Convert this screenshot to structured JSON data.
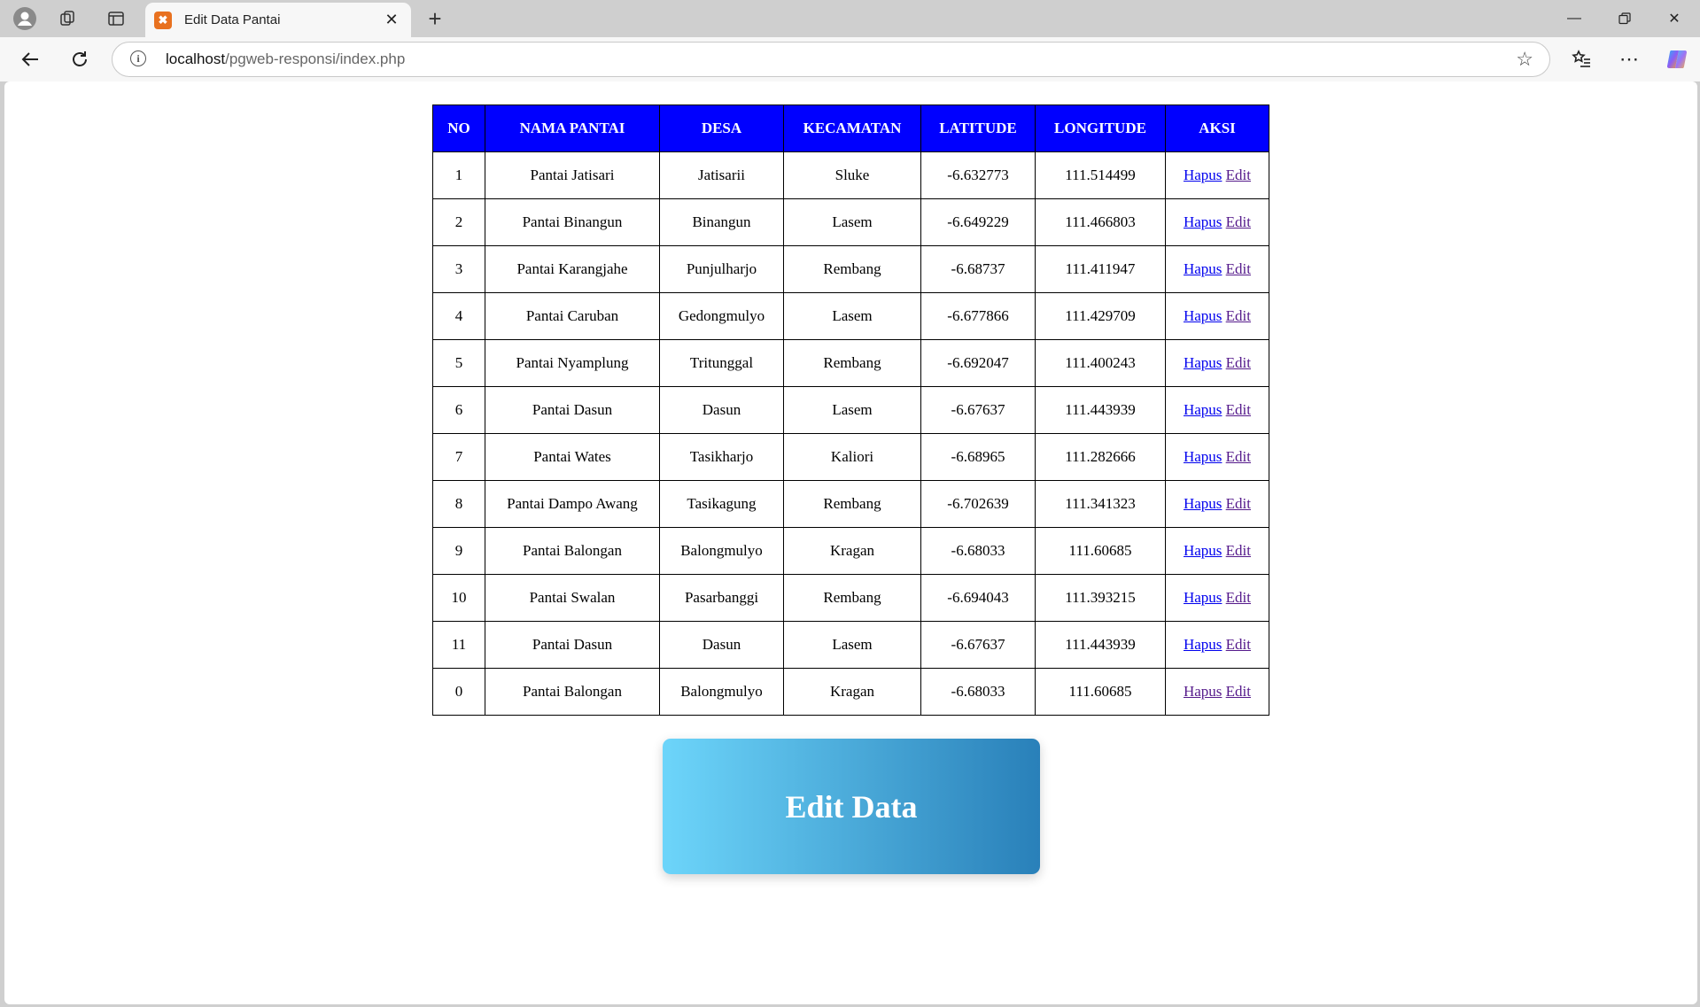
{
  "browser": {
    "tab_title": "Edit Data Pantai",
    "tab_favicon_letter": "✖",
    "url_host": "localhost",
    "url_path": "/pgweb-responsi/index.php"
  },
  "table": {
    "headers": [
      "NO",
      "NAMA PANTAI",
      "DESA",
      "KECAMATAN",
      "LATITUDE",
      "LONGITUDE",
      "AKSI"
    ],
    "action_delete_label": "Hapus",
    "action_edit_label": "Edit",
    "rows": [
      {
        "no": "1",
        "nama": "Pantai Jatisari",
        "desa": "Jatisarii",
        "kecamatan": "Sluke",
        "lat": "-6.632773",
        "lon": "111.514499"
      },
      {
        "no": "2",
        "nama": "Pantai Binangun",
        "desa": "Binangun",
        "kecamatan": "Lasem",
        "lat": "-6.649229",
        "lon": "111.466803"
      },
      {
        "no": "3",
        "nama": "Pantai Karangjahe",
        "desa": "Punjulharjo",
        "kecamatan": "Rembang",
        "lat": "-6.68737",
        "lon": "111.411947"
      },
      {
        "no": "4",
        "nama": "Pantai Caruban",
        "desa": "Gedongmulyo",
        "kecamatan": "Lasem",
        "lat": "-6.677866",
        "lon": "111.429709"
      },
      {
        "no": "5",
        "nama": "Pantai Nyamplung",
        "desa": "Tritunggal",
        "kecamatan": "Rembang",
        "lat": "-6.692047",
        "lon": "111.400243"
      },
      {
        "no": "6",
        "nama": "Pantai Dasun",
        "desa": "Dasun",
        "kecamatan": "Lasem",
        "lat": "-6.67637",
        "lon": "111.443939"
      },
      {
        "no": "7",
        "nama": "Pantai Wates",
        "desa": "Tasikharjo",
        "kecamatan": "Kaliori",
        "lat": "-6.68965",
        "lon": "111.282666"
      },
      {
        "no": "8",
        "nama": "Pantai Dampo Awang",
        "desa": "Tasikagung",
        "kecamatan": "Rembang",
        "lat": "-6.702639",
        "lon": "111.341323"
      },
      {
        "no": "9",
        "nama": "Pantai Balongan",
        "desa": "Balongmulyo",
        "kecamatan": "Kragan",
        "lat": "-6.68033",
        "lon": "111.60685"
      },
      {
        "no": "10",
        "nama": "Pantai Swalan",
        "desa": "Pasarbanggi",
        "kecamatan": "Rembang",
        "lat": "-6.694043",
        "lon": "111.393215"
      },
      {
        "no": "11",
        "nama": "Pantai Dasun",
        "desa": "Dasun",
        "kecamatan": "Lasem",
        "lat": "-6.67637",
        "lon": "111.443939"
      },
      {
        "no": "0",
        "nama": "Pantai Balongan",
        "desa": "Balongmulyo",
        "kecamatan": "Kragan",
        "lat": "-6.68033",
        "lon": "111.60685"
      }
    ]
  },
  "edit_button_label": "Edit Data",
  "colors": {
    "header_bg": "#0000ff",
    "link": "#0000ee",
    "link_visited": "#551a8b",
    "button_gradient_start": "#6dd5fa",
    "button_gradient_end": "#2980b9"
  }
}
